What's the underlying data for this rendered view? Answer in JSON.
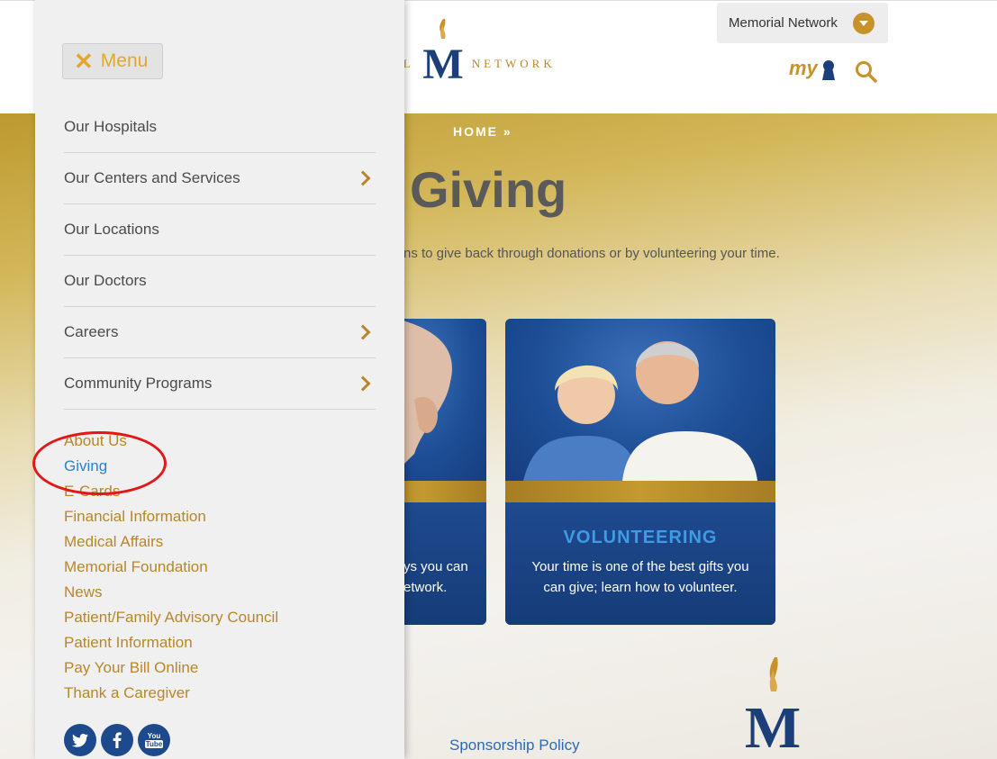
{
  "header": {
    "logo_left_word": "ORIAL",
    "logo_right_word": "NETWORK",
    "network_button_label": "Memorial Network",
    "my_label": "my"
  },
  "hero": {
    "breadcrumb": "HOME »",
    "title": "Giving",
    "intro": "ns to give back through donations or by volunteering your time."
  },
  "cards": [
    {
      "title": "",
      "desc_line1": "ys you can",
      "desc_line2": "etwork."
    },
    {
      "title": "VOLUNTEERING",
      "desc_line1": "Your time is one of the best gifts you",
      "desc_line2": "can give; learn how to volunteer."
    }
  ],
  "footer": {
    "sponsorship_link": "Sponsorship Policy"
  },
  "menu": {
    "button_label": "Menu",
    "primary": [
      {
        "label": "Our Hospitals",
        "has_submenu": false
      },
      {
        "label": "Our Centers and Services",
        "has_submenu": true
      },
      {
        "label": "Our Locations",
        "has_submenu": false
      },
      {
        "label": "Our Doctors",
        "has_submenu": false
      },
      {
        "label": "Careers",
        "has_submenu": true
      },
      {
        "label": "Community Programs",
        "has_submenu": true
      }
    ],
    "secondary": [
      {
        "label": "About Us"
      },
      {
        "label": "Giving",
        "active": true
      },
      {
        "label": "E-Cards"
      },
      {
        "label": "Financial Information"
      },
      {
        "label": "Medical Affairs"
      },
      {
        "label": "Memorial Foundation"
      },
      {
        "label": "News"
      },
      {
        "label": "Patient/Family Advisory Council"
      },
      {
        "label": "Patient Information"
      },
      {
        "label": "Pay Your Bill Online"
      },
      {
        "label": "Thank a Caregiver"
      }
    ],
    "social": [
      {
        "name": "twitter-icon"
      },
      {
        "name": "facebook-icon"
      },
      {
        "name": "youtube-icon",
        "glyph_top": "You",
        "glyph_bottom": "Tube"
      }
    ]
  },
  "colors": {
    "gold": "#b8862a",
    "navy": "#1c4a8d",
    "link_blue": "#2e80d2",
    "annotation_red": "#e51616"
  }
}
